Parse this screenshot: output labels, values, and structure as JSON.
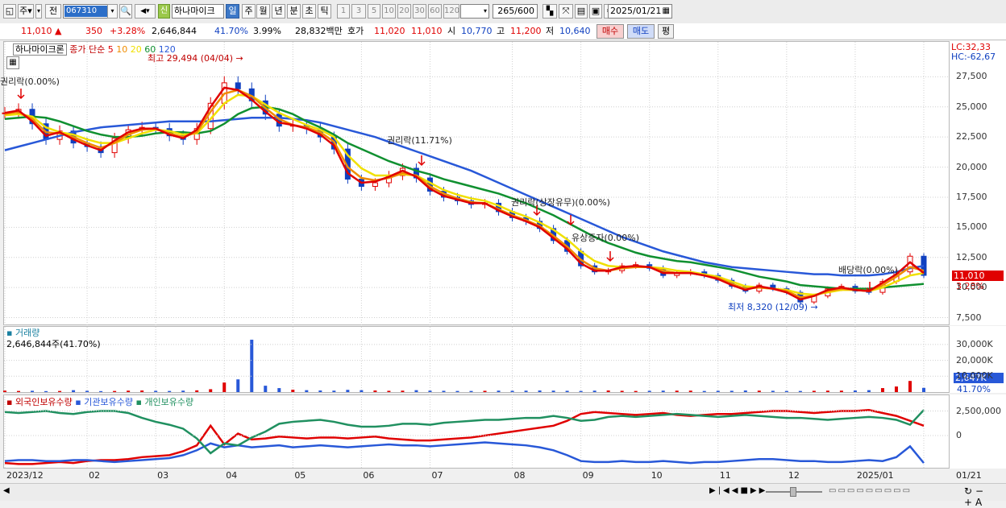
{
  "toolbar": {
    "btn_ju": "주",
    "btn_jeon": "전",
    "code": "067310",
    "name": "하나마이크",
    "periods": [
      "일",
      "주",
      "월",
      "년",
      "분",
      "초",
      "틱"
    ],
    "intervals": [
      "1",
      "3",
      "5",
      "10",
      "20",
      "30",
      "60",
      "120"
    ],
    "count": "265",
    "count_max": "/600",
    "date": "2025/01/21"
  },
  "quote": {
    "price": "11,010",
    "change": "350",
    "change_pct": "+3.28%",
    "volume": "2,646,844",
    "turnover_pct": "41.70%",
    "ratio": "3.99%",
    "amount": "28,832백만",
    "ask_label": "호가",
    "ask": "11,020",
    "bid": "11,010",
    "open_label": "시",
    "open": "10,770",
    "high_label": "고",
    "high": "11,200",
    "low_label": "저",
    "low": "10,640",
    "buy": "매수",
    "sell": "매도",
    "avg": "평"
  },
  "chart_data": [
    {
      "type": "line",
      "title": "하나마이크론",
      "legend": {
        "label": "종가 단순",
        "ma": [
          "5",
          "10",
          "20",
          "60",
          "120"
        ]
      },
      "x_ticks": [
        "2023/12",
        "02",
        "03",
        "04",
        "05",
        "06",
        "07",
        "08",
        "09",
        "10",
        "11",
        "12",
        "2025/01",
        "01/21"
      ],
      "y_ticks": [
        7500,
        10000,
        12500,
        15000,
        17500,
        20000,
        22500,
        25000,
        27500
      ],
      "ylim": [
        7000,
        30000
      ],
      "series": [
        {
          "name": "종가",
          "values": [
            24500,
            24800,
            23600,
            22300,
            23000,
            22000,
            21700,
            21200,
            22400,
            23100,
            23300,
            23200,
            22600,
            22300,
            23200,
            25300,
            27000,
            26500,
            25500,
            24400,
            23400,
            23500,
            23200,
            22500,
            21500,
            19000,
            18400,
            18700,
            19300,
            19900,
            19100,
            18000,
            17500,
            17200,
            16900,
            17000,
            16300,
            15800,
            15500,
            14900,
            13900,
            13000,
            11800,
            11300,
            11400,
            11800,
            11900,
            11600,
            11000,
            11200,
            11300,
            11000,
            10600,
            10100,
            9700,
            10200,
            9900,
            9600,
            8800,
            9300,
            9900,
            10100,
            9700,
            9600,
            10500,
            11300,
            12600,
            11010
          ]
        },
        {
          "name": "5",
          "values": [
            24500,
            24700,
            23800,
            22600,
            22900,
            22300,
            21800,
            21400,
            22200,
            22900,
            23200,
            23200,
            22700,
            22400,
            23100,
            25000,
            26600,
            26400,
            25600,
            24600,
            23700,
            23500,
            23200,
            22700,
            21800,
            19500,
            18700,
            18800,
            19200,
            19700,
            19200,
            18200,
            17600,
            17300,
            17000,
            17000,
            16400,
            15900,
            15500,
            15000,
            14100,
            13200,
            12000,
            11400,
            11400,
            11700,
            11800,
            11700,
            11200,
            11200,
            11200,
            11000,
            10700,
            10200,
            9800,
            10100,
            9900,
            9600,
            9000,
            9300,
            9800,
            10000,
            9800,
            9700,
            10400,
            11100,
            12100,
            11200
          ]
        },
        {
          "name": "10",
          "values": [
            24400,
            24600,
            24000,
            22900,
            22800,
            22500,
            22000,
            21600,
            22000,
            22700,
            23100,
            23200,
            22800,
            22500,
            22900,
            24600,
            26100,
            26400,
            25900,
            24900,
            24000,
            23500,
            23300,
            22900,
            22100,
            20000,
            19100,
            18900,
            19100,
            19500,
            19300,
            18400,
            17800,
            17400,
            17100,
            17000,
            16500,
            16000,
            15600,
            15100,
            14300,
            13400,
            12300,
            11600,
            11400,
            11600,
            11700,
            11700,
            11400,
            11200,
            11200,
            11000,
            10800,
            10300,
            9900,
            10000,
            9900,
            9700,
            9200,
            9300,
            9700,
            9900,
            9800,
            9700,
            10200,
            10900,
            11700,
            11400
          ]
        },
        {
          "name": "20",
          "values": [
            24300,
            24400,
            24200,
            23300,
            22900,
            22700,
            22300,
            22000,
            22000,
            22400,
            22800,
            23100,
            23000,
            22700,
            22800,
            24000,
            25300,
            26000,
            25900,
            25200,
            24500,
            24000,
            23500,
            23100,
            22500,
            21000,
            19900,
            19300,
            19300,
            19400,
            19300,
            18700,
            18100,
            17700,
            17400,
            17200,
            16800,
            16300,
            15900,
            15400,
            14800,
            14000,
            13000,
            12200,
            11800,
            11700,
            11700,
            11700,
            11600,
            11400,
            11300,
            11100,
            10900,
            10500,
            10100,
            10000,
            9900,
            9800,
            9500,
            9400,
            9600,
            9800,
            9800,
            9700,
            10000,
            10500,
            11000,
            11200
          ]
        },
        {
          "name": "60",
          "values": [
            24000,
            24100,
            24200,
            24100,
            23800,
            23400,
            23000,
            22700,
            22500,
            22500,
            22600,
            22800,
            22900,
            22900,
            22800,
            23000,
            23600,
            24400,
            24900,
            25000,
            24800,
            24400,
            23800,
            23300,
            22700,
            22000,
            21500,
            21000,
            20500,
            20100,
            19700,
            19400,
            19000,
            18700,
            18400,
            18100,
            17800,
            17400,
            17000,
            16500,
            16000,
            15400,
            14800,
            14200,
            13700,
            13300,
            12900,
            12600,
            12400,
            12200,
            12100,
            11900,
            11700,
            11500,
            11200,
            10900,
            10700,
            10500,
            10200,
            10100,
            10000,
            9900,
            9900,
            9900,
            10000,
            10100,
            10200,
            10300
          ]
        },
        {
          "name": "120",
          "values": [
            21400,
            21700,
            22000,
            22300,
            22600,
            22900,
            23100,
            23300,
            23400,
            23500,
            23600,
            23700,
            23800,
            23800,
            23800,
            23800,
            23900,
            24000,
            24100,
            24100,
            24100,
            24000,
            23900,
            23700,
            23400,
            23100,
            22800,
            22500,
            22100,
            21700,
            21300,
            20900,
            20500,
            20100,
            19700,
            19200,
            18700,
            18200,
            17700,
            17200,
            16700,
            16200,
            15700,
            15200,
            14700,
            14200,
            13800,
            13400,
            13000,
            12700,
            12400,
            12100,
            11900,
            11700,
            11600,
            11500,
            11400,
            11300,
            11200,
            11100,
            11100,
            11000,
            11000,
            11000,
            11100,
            11300,
            11600,
            11800
          ]
        }
      ],
      "annotations": [
        "권리락(0.00%)",
        "최고 29,494 (04/04)",
        "권리락(11.71%)",
        "권리락(상장유무)(0.00%)",
        "유상증자(0.00%)",
        "배당락(0.00%)",
        "최저 8,320 (12/09)"
      ],
      "side_labels": {
        "lc": "LC:32,33",
        "hc": "HC:-62,67",
        "price": "11,010",
        "pct": "3.28%"
      }
    },
    {
      "type": "bar",
      "title": "거래량",
      "current": "2,646,844주(41.70%)",
      "y_ticks": [
        "30,000K",
        "20,000K",
        "10,000K"
      ],
      "ylim": [
        0,
        35000
      ],
      "values": [
        900,
        700,
        800,
        600,
        700,
        1200,
        800,
        600,
        700,
        900,
        1000,
        800,
        700,
        900,
        1100,
        1800,
        6000,
        8000,
        33000,
        4000,
        2500,
        1500,
        1200,
        1000,
        900,
        1400,
        1200,
        1000,
        800,
        900,
        1200,
        900,
        800,
        700,
        700,
        800,
        900,
        800,
        900,
        1000,
        900,
        800,
        700,
        900,
        1000,
        800,
        700,
        800,
        900,
        900,
        900,
        700,
        800,
        800,
        1000,
        900,
        800,
        700,
        700,
        800,
        900,
        900,
        1000,
        1200,
        2500,
        3500,
        7000,
        2647
      ],
      "side_labels": {
        "value": "2,647K",
        "pct": "41.70%"
      }
    },
    {
      "type": "line",
      "title": "보유수량",
      "legend": [
        "외국인보유수량",
        "기관보유수량",
        "개인보유수량"
      ],
      "y_ticks": [
        "2,500,000",
        "0"
      ],
      "series": [
        {
          "name": "외국인보유수량",
          "values": [
            -2800000,
            -2900000,
            -2900000,
            -2800000,
            -2700000,
            -2800000,
            -2600000,
            -2500000,
            -2500000,
            -2400000,
            -2200000,
            -2100000,
            -2000000,
            -1600000,
            -1000000,
            1000000,
            -900000,
            200000,
            -400000,
            -300000,
            -100000,
            -200000,
            -300000,
            -200000,
            -200000,
            -300000,
            -200000,
            -100000,
            -300000,
            -400000,
            -500000,
            -500000,
            -400000,
            -300000,
            -200000,
            0,
            200000,
            400000,
            600000,
            800000,
            1000000,
            1500000,
            2200000,
            2400000,
            2300000,
            2200000,
            2100000,
            2200000,
            2300000,
            2100000,
            2000000,
            2100000,
            2200000,
            2200000,
            2300000,
            2400000,
            2500000,
            2500000,
            2400000,
            2300000,
            2400000,
            2500000,
            2500000,
            2600000,
            2300000,
            2000000,
            1500000,
            1000000
          ]
        },
        {
          "name": "기관보유수량",
          "values": [
            -2600000,
            -2500000,
            -2500000,
            -2600000,
            -2600000,
            -2500000,
            -2500000,
            -2600000,
            -2700000,
            -2600000,
            -2500000,
            -2400000,
            -2300000,
            -2000000,
            -1500000,
            -800000,
            -1200000,
            -1000000,
            -1200000,
            -1100000,
            -1000000,
            -1200000,
            -1100000,
            -1000000,
            -1100000,
            -1200000,
            -1100000,
            -1000000,
            -900000,
            -1000000,
            -1000000,
            -1100000,
            -1000000,
            -900000,
            -800000,
            -700000,
            -800000,
            -900000,
            -1000000,
            -1200000,
            -1500000,
            -2000000,
            -2600000,
            -2700000,
            -2700000,
            -2600000,
            -2700000,
            -2700000,
            -2600000,
            -2700000,
            -2800000,
            -2700000,
            -2700000,
            -2600000,
            -2500000,
            -2400000,
            -2400000,
            -2500000,
            -2600000,
            -2600000,
            -2700000,
            -2700000,
            -2600000,
            -2500000,
            -2600000,
            -2200000,
            -1100000,
            -2800000
          ]
        },
        {
          "name": "개인보유수량",
          "values": [
            2400000,
            2300000,
            2400000,
            2500000,
            2300000,
            2200000,
            2400000,
            2500000,
            2500000,
            2300000,
            1800000,
            1400000,
            1100000,
            700000,
            -300000,
            -1800000,
            -800000,
            -1000000,
            -200000,
            400000,
            1200000,
            1400000,
            1500000,
            1600000,
            1400000,
            1100000,
            900000,
            900000,
            1000000,
            1200000,
            1200000,
            1100000,
            1300000,
            1400000,
            1500000,
            1600000,
            1600000,
            1700000,
            1800000,
            1800000,
            2000000,
            1800000,
            1500000,
            1600000,
            1900000,
            2000000,
            1900000,
            2000000,
            2100000,
            2200000,
            2100000,
            2000000,
            1900000,
            2000000,
            2100000,
            2000000,
            1900000,
            1800000,
            1800000,
            1700000,
            1600000,
            1700000,
            1800000,
            1900000,
            1800000,
            1600000,
            1100000,
            2600000
          ]
        }
      ]
    }
  ],
  "colors": {
    "ma5": "#e00000",
    "ma10": "#f08c00",
    "ma20": "#f0e000",
    "ma60": "#109030",
    "ma120": "#2858d8",
    "up": "#e00000",
    "down": "#1040c0",
    "foreign": "#e00000",
    "inst": "#2858d8",
    "indiv": "#209060"
  }
}
